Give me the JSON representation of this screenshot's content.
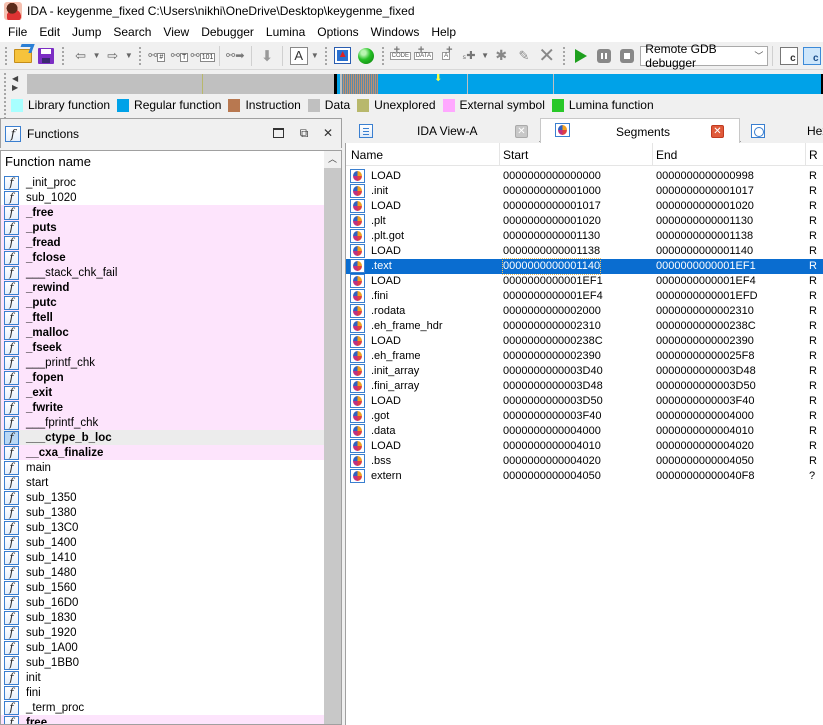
{
  "window": {
    "title": "IDA - keygenme_fixed C:\\Users\\nikhi\\OneDrive\\Desktop\\keygenme_fixed"
  },
  "menu": [
    "File",
    "Edit",
    "Jump",
    "Search",
    "View",
    "Debugger",
    "Lumina",
    "Options",
    "Windows",
    "Help"
  ],
  "toolbar": {
    "debugger_select": "Remote GDB debugger"
  },
  "navigator": {
    "colors": {
      "data": "#c0c0c0",
      "regular": "#00a2e8",
      "unexplored": "#b8b86c",
      "black": "#000000",
      "striped": "#6a8fa8",
      "marker": "#ffff40"
    }
  },
  "legend": [
    {
      "label": "Library function",
      "color": "#a8ffff"
    },
    {
      "label": "Regular function",
      "color": "#00a2e8"
    },
    {
      "label": "Instruction",
      "color": "#b87850"
    },
    {
      "label": "Data",
      "color": "#c0c0c0"
    },
    {
      "label": "Unexplored",
      "color": "#b8b86c"
    },
    {
      "label": "External symbol",
      "color": "#ffa8ff"
    },
    {
      "label": "Lumina function",
      "color": "#28c828"
    }
  ],
  "functions_panel": {
    "title": "Functions",
    "column": "Function name",
    "items": [
      {
        "name": "_init_proc",
        "type": "regular"
      },
      {
        "name": "sub_1020",
        "type": "regular"
      },
      {
        "name": "_free",
        "type": "external",
        "bold": true
      },
      {
        "name": "_puts",
        "type": "external",
        "bold": true
      },
      {
        "name": "_fread",
        "type": "external",
        "bold": true
      },
      {
        "name": "_fclose",
        "type": "external",
        "bold": true
      },
      {
        "name": "___stack_chk_fail",
        "type": "external",
        "bold": false
      },
      {
        "name": "_rewind",
        "type": "external",
        "bold": true
      },
      {
        "name": "_putc",
        "type": "external",
        "bold": true
      },
      {
        "name": "_ftell",
        "type": "external",
        "bold": true
      },
      {
        "name": "_malloc",
        "type": "external",
        "bold": true
      },
      {
        "name": "_fseek",
        "type": "external",
        "bold": true
      },
      {
        "name": "___printf_chk",
        "type": "external",
        "bold": false
      },
      {
        "name": "_fopen",
        "type": "external",
        "bold": true
      },
      {
        "name": "_exit",
        "type": "external",
        "bold": true
      },
      {
        "name": "_fwrite",
        "type": "external",
        "bold": true
      },
      {
        "name": "___fprintf_chk",
        "type": "external",
        "bold": false
      },
      {
        "name": "___ctype_b_loc",
        "type": "selected",
        "bold": true
      },
      {
        "name": "__cxa_finalize",
        "type": "external",
        "bold": true
      },
      {
        "name": "main",
        "type": "regular"
      },
      {
        "name": "start",
        "type": "regular"
      },
      {
        "name": "sub_1350",
        "type": "regular"
      },
      {
        "name": "sub_1380",
        "type": "regular"
      },
      {
        "name": "sub_13C0",
        "type": "regular"
      },
      {
        "name": "sub_1400",
        "type": "regular"
      },
      {
        "name": "sub_1410",
        "type": "regular"
      },
      {
        "name": "sub_1480",
        "type": "regular"
      },
      {
        "name": "sub_1560",
        "type": "regular"
      },
      {
        "name": "sub_16D0",
        "type": "regular"
      },
      {
        "name": "sub_1830",
        "type": "regular"
      },
      {
        "name": "sub_1920",
        "type": "regular"
      },
      {
        "name": "sub_1A00",
        "type": "regular"
      },
      {
        "name": "sub_1BB0",
        "type": "regular"
      },
      {
        "name": "init",
        "type": "regular"
      },
      {
        "name": "fini",
        "type": "regular"
      },
      {
        "name": "_term_proc",
        "type": "regular"
      },
      {
        "name": "free",
        "type": "external",
        "bold": true
      }
    ]
  },
  "tabs": [
    {
      "label": "IDA View-A",
      "active": false
    },
    {
      "label": "Segments",
      "active": true
    },
    {
      "label": "Hex",
      "active": false
    }
  ],
  "segments": {
    "columns": [
      "Name",
      "Start",
      "End",
      "R"
    ],
    "rows": [
      {
        "name": "LOAD",
        "start": "0000000000000000",
        "end": "0000000000000998",
        "r": "R"
      },
      {
        "name": ".init",
        "start": "0000000000001000",
        "end": "0000000000001017",
        "r": "R"
      },
      {
        "name": "LOAD",
        "start": "0000000000001017",
        "end": "0000000000001020",
        "r": "R"
      },
      {
        "name": ".plt",
        "start": "0000000000001020",
        "end": "0000000000001130",
        "r": "R"
      },
      {
        "name": ".plt.got",
        "start": "0000000000001130",
        "end": "0000000000001138",
        "r": "R"
      },
      {
        "name": "LOAD",
        "start": "0000000000001138",
        "end": "0000000000001140",
        "r": "R"
      },
      {
        "name": ".text",
        "start": "0000000000001140",
        "end": "0000000000001EF1",
        "r": "R",
        "selected": true
      },
      {
        "name": "LOAD",
        "start": "0000000000001EF1",
        "end": "0000000000001EF4",
        "r": "R"
      },
      {
        "name": ".fini",
        "start": "0000000000001EF4",
        "end": "0000000000001EFD",
        "r": "R"
      },
      {
        "name": ".rodata",
        "start": "0000000000002000",
        "end": "0000000000002310",
        "r": "R"
      },
      {
        "name": ".eh_frame_hdr",
        "start": "0000000000002310",
        "end": "000000000000238C",
        "r": "R"
      },
      {
        "name": "LOAD",
        "start": "000000000000238C",
        "end": "0000000000002390",
        "r": "R"
      },
      {
        "name": ".eh_frame",
        "start": "0000000000002390",
        "end": "00000000000025F8",
        "r": "R"
      },
      {
        "name": ".init_array",
        "start": "0000000000003D40",
        "end": "0000000000003D48",
        "r": "R"
      },
      {
        "name": ".fini_array",
        "start": "0000000000003D48",
        "end": "0000000000003D50",
        "r": "R"
      },
      {
        "name": "LOAD",
        "start": "0000000000003D50",
        "end": "0000000000003F40",
        "r": "R"
      },
      {
        "name": ".got",
        "start": "0000000000003F40",
        "end": "0000000000004000",
        "r": "R"
      },
      {
        "name": ".data",
        "start": "0000000000004000",
        "end": "0000000000004010",
        "r": "R"
      },
      {
        "name": "LOAD",
        "start": "0000000000004010",
        "end": "0000000000004020",
        "r": "R"
      },
      {
        "name": ".bss",
        "start": "0000000000004020",
        "end": "0000000000004050",
        "r": "R"
      },
      {
        "name": "extern",
        "start": "0000000000004050",
        "end": "00000000000040F8",
        "r": "?"
      }
    ]
  }
}
